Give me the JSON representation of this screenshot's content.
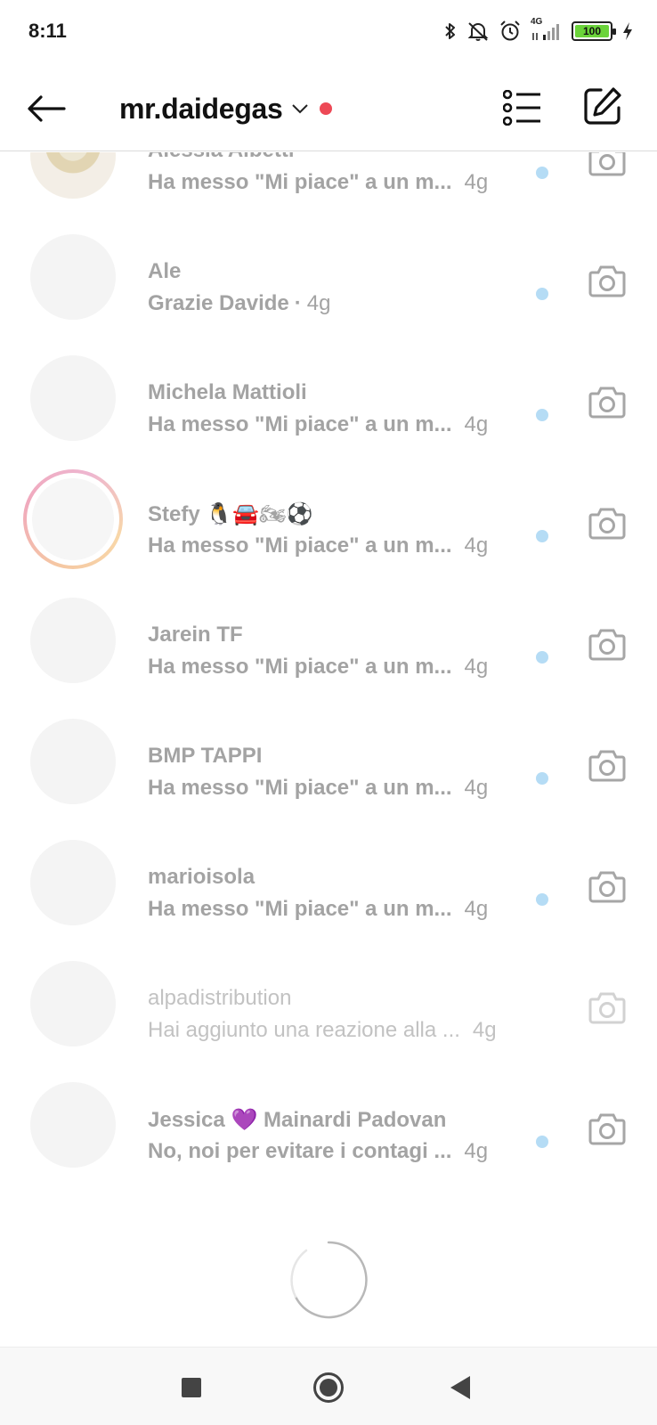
{
  "status_bar": {
    "time": "8:11",
    "network": "4G",
    "battery": "100",
    "icons": [
      "bluetooth-icon",
      "bell-off-icon",
      "alarm-icon",
      "signal-icon",
      "battery-icon",
      "charging-icon"
    ]
  },
  "header": {
    "account_name": "mr.daidegas",
    "back_icon": "arrow-left-icon",
    "dropdown_icon": "chevron-down-icon",
    "list_icon": "list-icon",
    "compose_icon": "compose-icon",
    "notification_dot_color": "#ed4956"
  },
  "threads": [
    {
      "name": "Alessia Albetti",
      "preview": "Ha messo \"Mi piace\" a un m...",
      "time": "4g",
      "unread": true
    },
    {
      "name": "Ale",
      "preview": "Grazie Davide",
      "separator": "·",
      "time": "4g",
      "unread": true
    },
    {
      "name": "Michela Mattioli",
      "preview": "Ha messo \"Mi piace\" a un m...",
      "time": "4g",
      "unread": true
    },
    {
      "name": "Stefy",
      "name_emoji": "🐧🚘🏍⚽",
      "preview": "Ha messo \"Mi piace\" a un m...",
      "time": "4g",
      "unread": true,
      "story_ring": true
    },
    {
      "name": "Jarein TF",
      "preview": "Ha messo \"Mi piace\" a un m...",
      "time": "4g",
      "unread": true
    },
    {
      "name": "BMP TAPPI",
      "preview": "Ha messo \"Mi piace\" a un m...",
      "time": "4g",
      "unread": true
    },
    {
      "name": "marioisola",
      "preview": "Ha messo \"Mi piace\" a un m...",
      "time": "4g",
      "unread": true
    },
    {
      "name": "alpadistribution",
      "preview": "Hai aggiunto una reazione alla ...",
      "time": "4g",
      "unread": false
    },
    {
      "name": "Jessica",
      "name_emoji": "💜",
      "name_suffix": "Mainardi Padovan",
      "preview": "No, noi per evitare i contagi ...",
      "time": "4g",
      "unread": true
    }
  ],
  "colors": {
    "unread_dot": "#b5dcf5",
    "text_muted": "#a3a3a3",
    "text_read": "#c2c2c2"
  },
  "loading_spinner": "spinner-icon",
  "nav_bar": {
    "recents_icon": "square-icon",
    "home_icon": "circle-icon",
    "back_icon": "triangle-back-icon"
  }
}
